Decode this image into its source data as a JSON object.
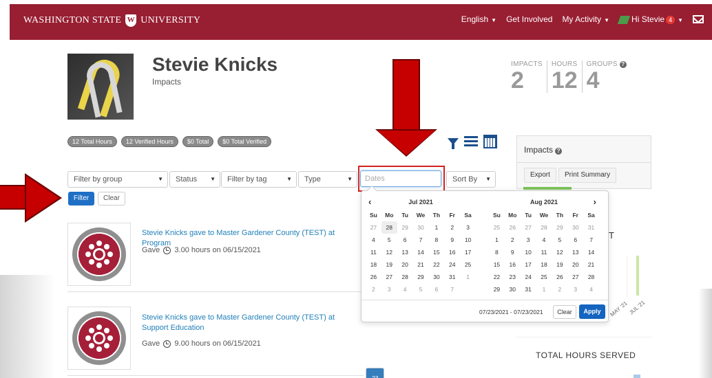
{
  "header": {
    "brand_left": "WASHINGTON STATE",
    "brand_right": "UNIVERSITY",
    "nav": {
      "language": "English",
      "get_involved": "Get Involved",
      "my_activity": "My Activity",
      "greeting": "Hi Stevie",
      "notification_count": "4"
    }
  },
  "profile": {
    "name": "Stevie Knicks",
    "subtitle": "Impacts"
  },
  "stats": [
    {
      "label": "IMPACTS",
      "value": "2"
    },
    {
      "label": "HOURS",
      "value": "12"
    },
    {
      "label": "GROUPS",
      "value": "4"
    }
  ],
  "pills": [
    "12 Total Hours",
    "12 Verified Hours",
    "$0 Total",
    "$0 Total Verified"
  ],
  "filters": {
    "group": "Filter by group",
    "status": "Status",
    "tag": "Filter by tag",
    "type": "Type",
    "dates_placeholder": "Dates",
    "sort": "Sort By",
    "filter_button": "Filter",
    "clear_button": "Clear"
  },
  "feed": [
    {
      "title": "Stevie Knicks gave to Master Gardener County (TEST) at Program",
      "meta_prefix": "Gave",
      "meta_suffix": "3.00 hours on 06/15/2021"
    },
    {
      "title": "Stevie Knicks gave to Master Gardener County (TEST) at Support Education",
      "meta_prefix": "Gave",
      "meta_suffix": "9.00 hours on 06/15/2021"
    }
  ],
  "sidebar": {
    "impacts_title": "Impacts",
    "export": "Export",
    "print_summary": "Print Summary",
    "partial_label": "T",
    "axis_labels": [
      "MAY '21",
      "JUL '21"
    ],
    "total_hours_title": "TOTAL HOURS SERVED"
  },
  "datepicker": {
    "weekdays": [
      "Su",
      "Mo",
      "Tu",
      "We",
      "Th",
      "Fr",
      "Sa"
    ],
    "left": {
      "month": "Jul 2021",
      "days": [
        {
          "d": "27",
          "off": true
        },
        {
          "d": "28",
          "today": true
        },
        {
          "d": "29",
          "off": true
        },
        {
          "d": "30",
          "off": true
        },
        {
          "d": "1"
        },
        {
          "d": "2"
        },
        {
          "d": "3"
        },
        {
          "d": "4"
        },
        {
          "d": "5"
        },
        {
          "d": "6"
        },
        {
          "d": "7"
        },
        {
          "d": "8"
        },
        {
          "d": "9"
        },
        {
          "d": "10"
        },
        {
          "d": "11"
        },
        {
          "d": "12"
        },
        {
          "d": "13"
        },
        {
          "d": "14"
        },
        {
          "d": "15"
        },
        {
          "d": "16"
        },
        {
          "d": "17"
        },
        {
          "d": "18"
        },
        {
          "d": "19"
        },
        {
          "d": "20"
        },
        {
          "d": "21"
        },
        {
          "d": "22"
        },
        {
          "d": "23",
          "selected": true
        },
        {
          "d": "24"
        },
        {
          "d": "25"
        },
        {
          "d": "26"
        },
        {
          "d": "27"
        },
        {
          "d": "28"
        },
        {
          "d": "29"
        },
        {
          "d": "30"
        },
        {
          "d": "31"
        },
        {
          "d": "1",
          "off": true
        },
        {
          "d": "2",
          "off": true
        },
        {
          "d": "3",
          "off": true
        },
        {
          "d": "4",
          "off": true
        },
        {
          "d": "5",
          "off": true
        },
        {
          "d": "6",
          "off": true
        },
        {
          "d": "7",
          "off": true
        }
      ]
    },
    "right": {
      "month": "Aug 2021",
      "days": [
        {
          "d": "25",
          "off": true
        },
        {
          "d": "26",
          "off": true
        },
        {
          "d": "27",
          "off": true
        },
        {
          "d": "28",
          "off": true
        },
        {
          "d": "29",
          "off": true
        },
        {
          "d": "30",
          "off": true
        },
        {
          "d": "31",
          "off": true
        },
        {
          "d": "1"
        },
        {
          "d": "2"
        },
        {
          "d": "3"
        },
        {
          "d": "4"
        },
        {
          "d": "5"
        },
        {
          "d": "6"
        },
        {
          "d": "7"
        },
        {
          "d": "8"
        },
        {
          "d": "9"
        },
        {
          "d": "10"
        },
        {
          "d": "11"
        },
        {
          "d": "12"
        },
        {
          "d": "13"
        },
        {
          "d": "14"
        },
        {
          "d": "15"
        },
        {
          "d": "16"
        },
        {
          "d": "17"
        },
        {
          "d": "18"
        },
        {
          "d": "19"
        },
        {
          "d": "20"
        },
        {
          "d": "21"
        },
        {
          "d": "22"
        },
        {
          "d": "23"
        },
        {
          "d": "24"
        },
        {
          "d": "25"
        },
        {
          "d": "26"
        },
        {
          "d": "27"
        },
        {
          "d": "28"
        },
        {
          "d": "29"
        },
        {
          "d": "30"
        },
        {
          "d": "31"
        },
        {
          "d": "1",
          "off": true
        },
        {
          "d": "2",
          "off": true
        },
        {
          "d": "3",
          "off": true
        },
        {
          "d": "4",
          "off": true
        }
      ]
    },
    "range_text": "07/23/2021 - 07/23/2021",
    "clear": "Clear",
    "apply": "Apply"
  },
  "colors": {
    "brand": "#981e32",
    "primary_button": "#1f6fc5",
    "selected_day": "#357ebd",
    "callout_arrow": "#c60000"
  }
}
